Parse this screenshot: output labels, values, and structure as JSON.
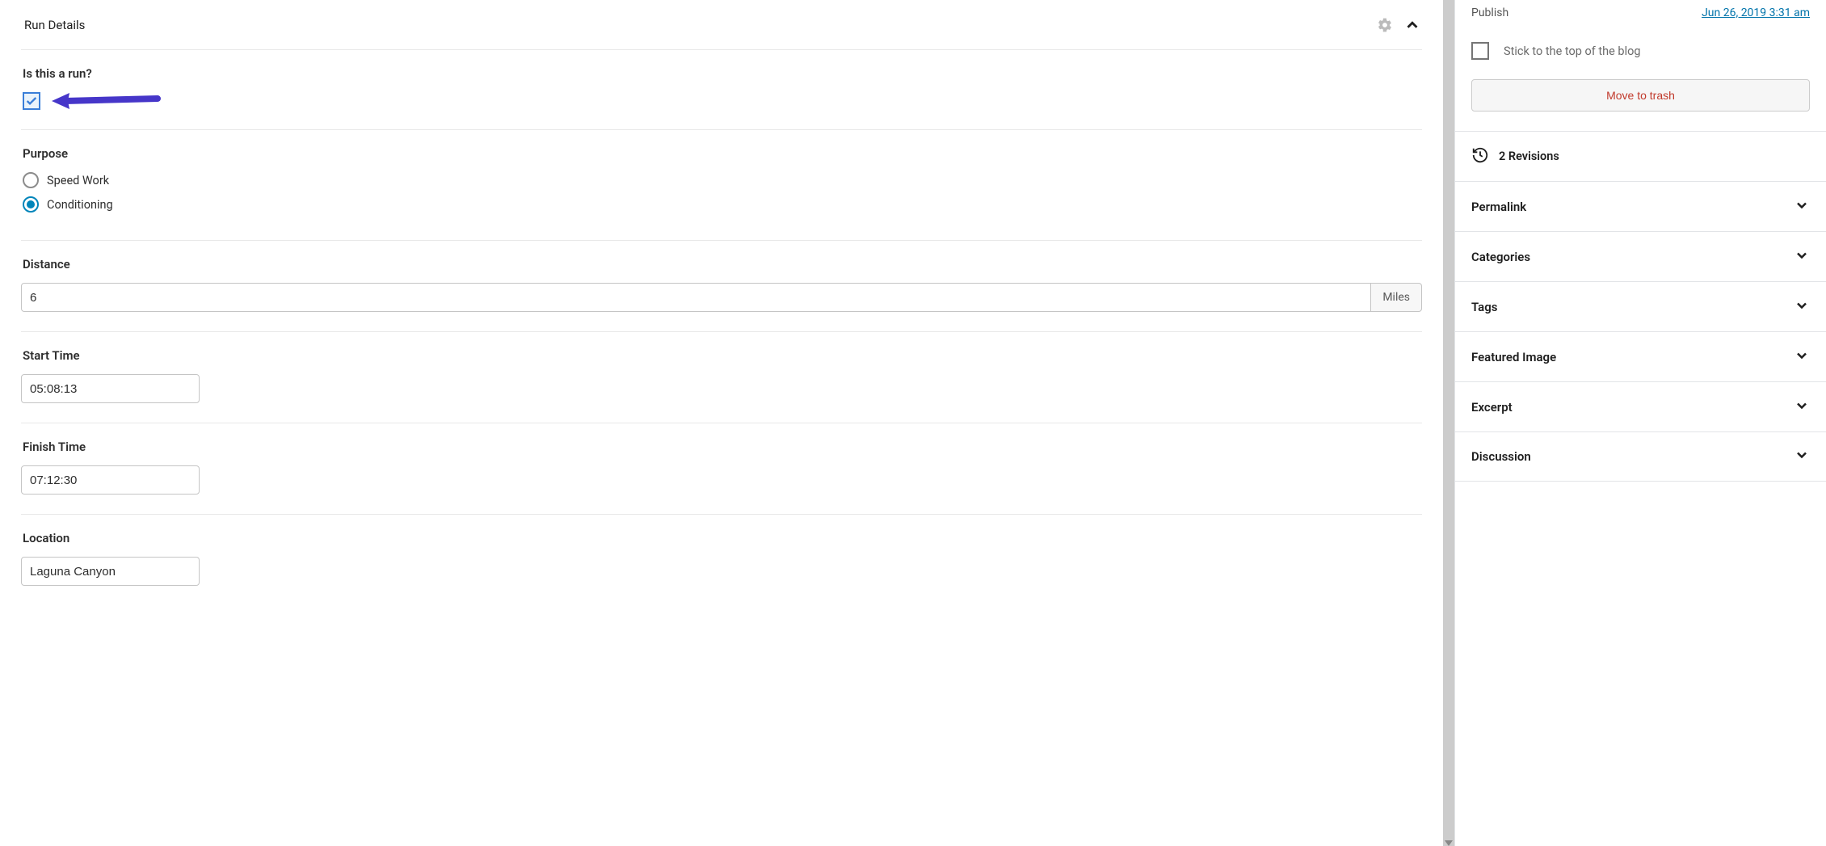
{
  "main": {
    "panel_title": "Run Details",
    "fields": {
      "is_run_label": "Is this a run?",
      "purpose_label": "Purpose",
      "purpose_options": {
        "speed": "Speed Work",
        "conditioning": "Conditioning"
      },
      "purpose_selected": "conditioning",
      "distance_label": "Distance",
      "distance_value": "6",
      "distance_unit": "Miles",
      "start_label": "Start Time",
      "start_value": "05:08:13",
      "finish_label": "Finish Time",
      "finish_value": "07:12:30",
      "location_label": "Location",
      "location_value": "Laguna Canyon"
    }
  },
  "sidebar": {
    "publish_label": "Publish",
    "publish_date": "Jun 26, 2019 3:31 am",
    "stick_label": "Stick to the top of the blog",
    "trash_label": "Move to trash",
    "revisions_text": "2 Revisions",
    "sections": {
      "permalink": "Permalink",
      "categories": "Categories",
      "tags": "Tags",
      "featured_image": "Featured Image",
      "excerpt": "Excerpt",
      "discussion": "Discussion"
    }
  }
}
